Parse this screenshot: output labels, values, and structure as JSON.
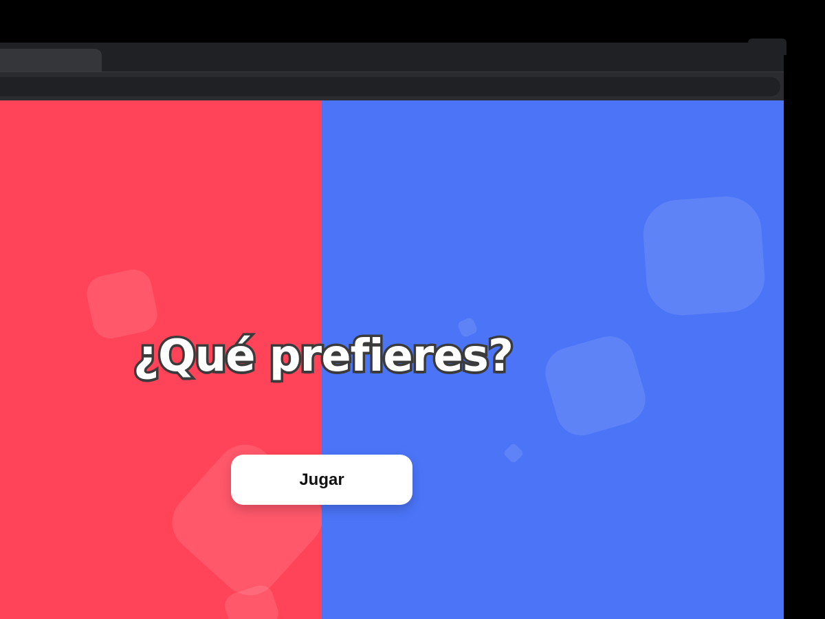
{
  "page": {
    "headline": "¿Qué prefieres?",
    "play_button_label": "Jugar"
  },
  "theme": {
    "left_panel_color": "#ff4459",
    "right_panel_color": "#4b74f7",
    "button_background": "#ffffff",
    "button_text_color": "#111111",
    "headline_text_color": "#ffffff",
    "headline_outline_color": "#3b3b3b"
  }
}
